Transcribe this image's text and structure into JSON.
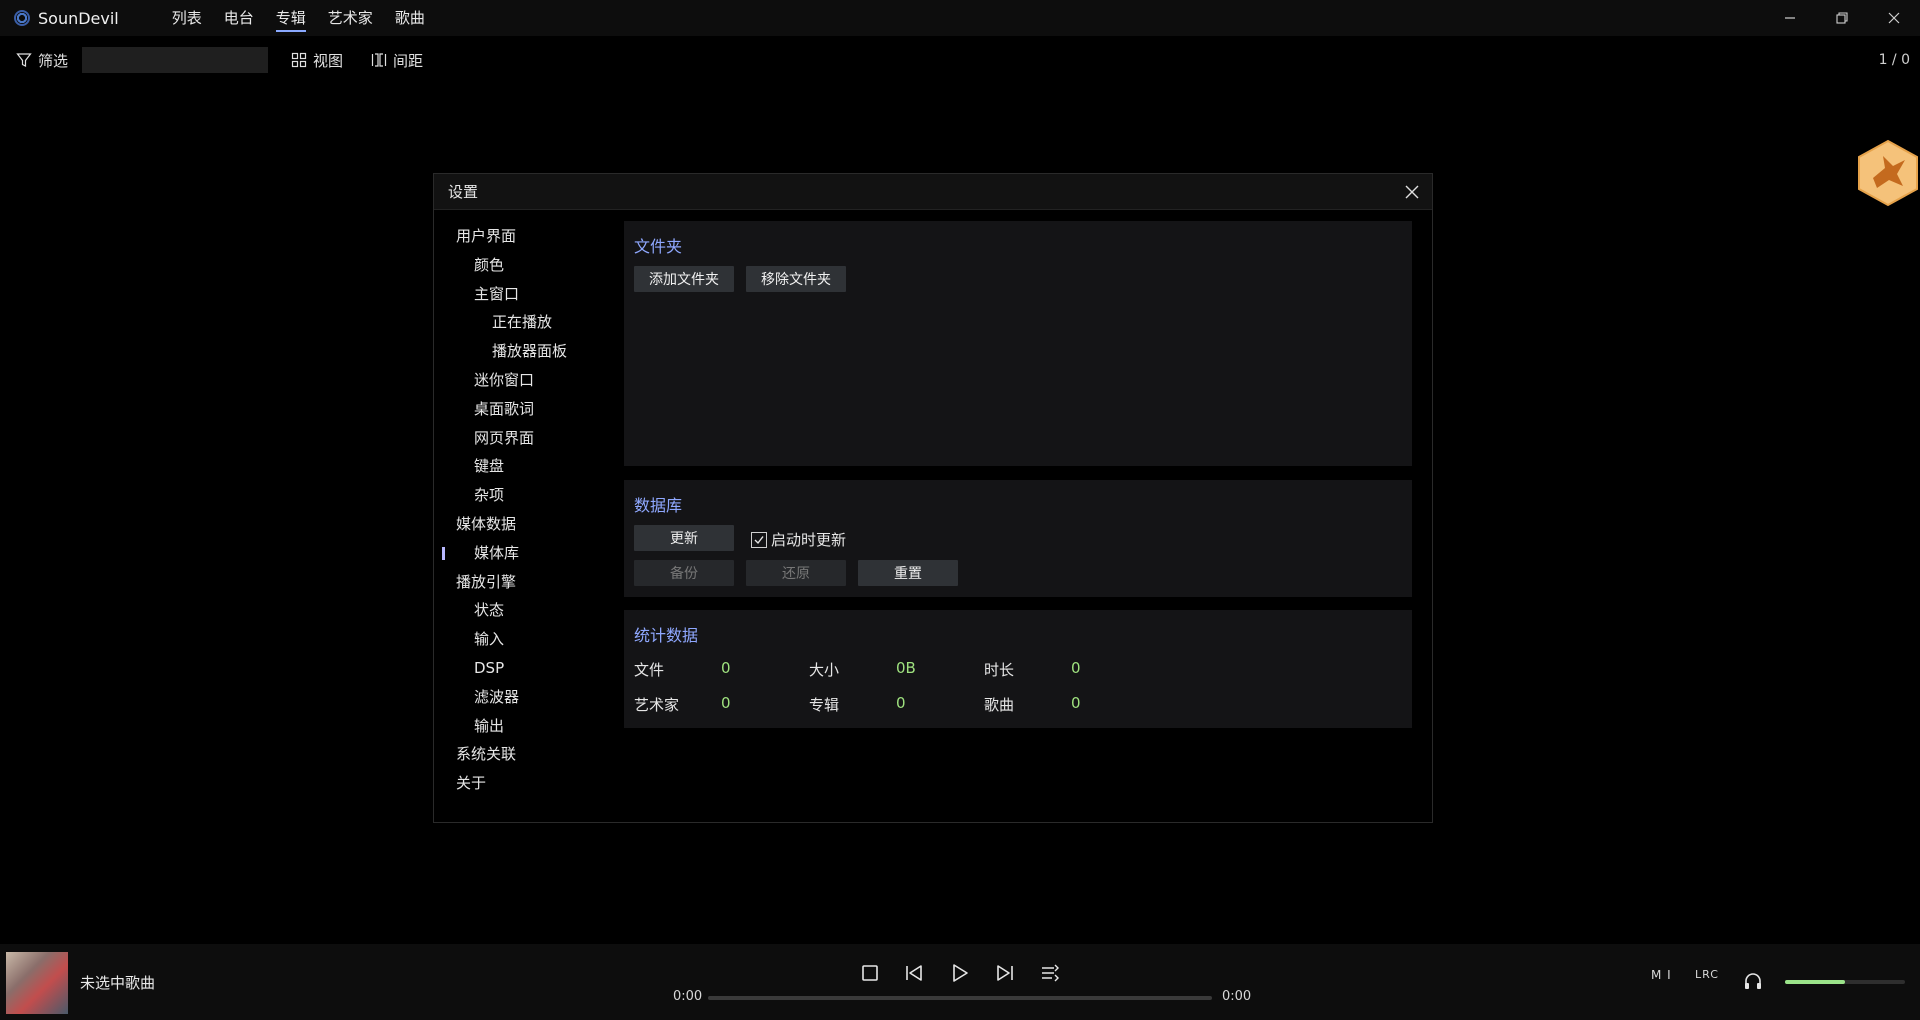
{
  "app": {
    "name": "SounDevil"
  },
  "nav": {
    "items": [
      {
        "label": "列表"
      },
      {
        "label": "电台"
      },
      {
        "label": "专辑",
        "active": true
      },
      {
        "label": "艺术家"
      },
      {
        "label": "歌曲"
      }
    ]
  },
  "window_controls": {
    "icons": [
      "minimize-icon",
      "restore-icon",
      "close-icon"
    ]
  },
  "toolbar": {
    "filter_label": "筛选",
    "search_value": "",
    "view_label": "视图",
    "spacing_label": "间距",
    "page_count": "1 / 0"
  },
  "settings": {
    "title": "设置",
    "tree": [
      {
        "label": "用户界面",
        "level": 0
      },
      {
        "label": "颜色",
        "level": 1
      },
      {
        "label": "主窗口",
        "level": 1
      },
      {
        "label": "正在播放",
        "level": 2
      },
      {
        "label": "播放器面板",
        "level": 2
      },
      {
        "label": "迷你窗口",
        "level": 1
      },
      {
        "label": "桌面歌词",
        "level": 1
      },
      {
        "label": "网页界面",
        "level": 1
      },
      {
        "label": "键盘",
        "level": 1
      },
      {
        "label": "杂项",
        "level": 1
      },
      {
        "label": "媒体数据",
        "level": 0
      },
      {
        "label": "媒体库",
        "level": 1,
        "selected": true
      },
      {
        "label": "播放引擎",
        "level": 0
      },
      {
        "label": "状态",
        "level": 1
      },
      {
        "label": "输入",
        "level": 1
      },
      {
        "label": "DSP",
        "level": 1
      },
      {
        "label": "滤波器",
        "level": 1
      },
      {
        "label": "输出",
        "level": 1
      },
      {
        "label": "系统关联",
        "level": 0
      },
      {
        "label": "关于",
        "level": 0
      }
    ],
    "folders": {
      "title": "文件夹",
      "add_label": "添加文件夹",
      "remove_label": "移除文件夹"
    },
    "database": {
      "title": "数据库",
      "update_label": "更新",
      "update_on_start_label": "启动时更新",
      "update_on_start_checked": true,
      "backup_label": "备份",
      "restore_label": "还原",
      "reset_label": "重置"
    },
    "stats": {
      "title": "统计数据",
      "files_label": "文件",
      "files_value": "0",
      "size_label": "大小",
      "size_value": "0B",
      "duration_label": "时长",
      "duration_value": "0",
      "artists_label": "艺术家",
      "artists_value": "0",
      "albums_label": "专辑",
      "albums_value": "0",
      "songs_label": "歌曲",
      "songs_value": "0"
    }
  },
  "player": {
    "song_title": "未选中歌曲",
    "time_current": "0:00",
    "time_total": "0:00",
    "progress": 0,
    "mini_label": "M I",
    "lrc_label": "LRC",
    "volume": 0.5
  },
  "colors": {
    "accent": "#8fa8ff",
    "stat_value": "#9fe27f",
    "volume": "#9be38a",
    "background": "#000000"
  }
}
